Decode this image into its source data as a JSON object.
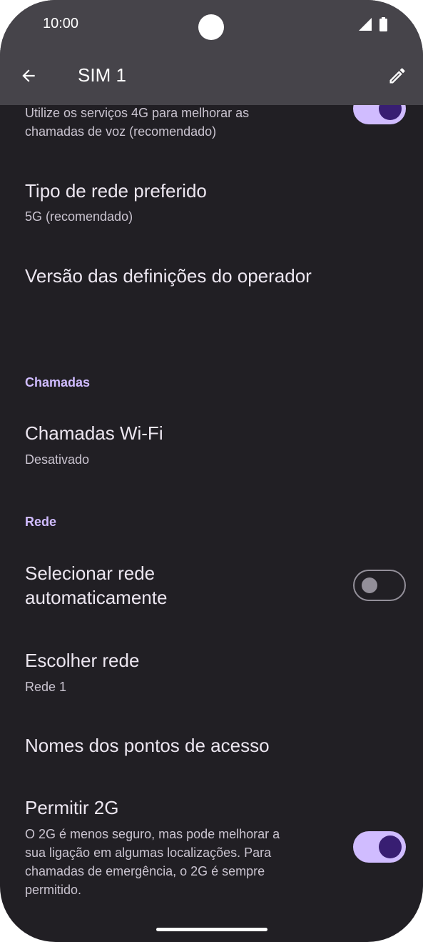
{
  "status_bar": {
    "time": "10:00",
    "icons": [
      "signal-icon",
      "battery-icon"
    ]
  },
  "app_bar": {
    "title": "SIM 1",
    "back_icon": "arrow-back-icon",
    "edit_icon": "pencil-icon"
  },
  "colors": {
    "background": "#211f24",
    "app_bar": "#46444a",
    "accent": "#d0bcff",
    "switch_thumb_on": "#381e72"
  },
  "settings": {
    "volte_summary_line1": "Utilize os serviços 4G para melhorar as",
    "volte_summary_line2": "chamadas de voz (recomendado)",
    "volte_switch_on": true,
    "network_type_title": "Tipo de rede preferido",
    "network_type_summary": "5G (recomendado)",
    "carrier_settings_title": "Versão das definições do operador",
    "calls_section": "Chamadas",
    "wifi_calling_title": "Chamadas Wi-Fi",
    "wifi_calling_summary": "Desativado",
    "network_section": "Rede",
    "auto_select_line1": "Selecionar rede",
    "auto_select_line2": "automaticamente",
    "auto_select_switch_on": false,
    "choose_network_title": "Escolher rede",
    "choose_network_summary": "Rede 1",
    "apn_title": "Nomes dos pontos de acesso",
    "allow_2g_title": "Permitir 2G",
    "allow_2g_summary_line1": "O 2G é menos seguro, mas pode melhorar a",
    "allow_2g_summary_line2": "sua ligação em algumas localizações. Para",
    "allow_2g_summary_line3": "chamadas de emergência, o 2G é sempre",
    "allow_2g_summary_line4": "permitido.",
    "allow_2g_switch_on": true
  }
}
